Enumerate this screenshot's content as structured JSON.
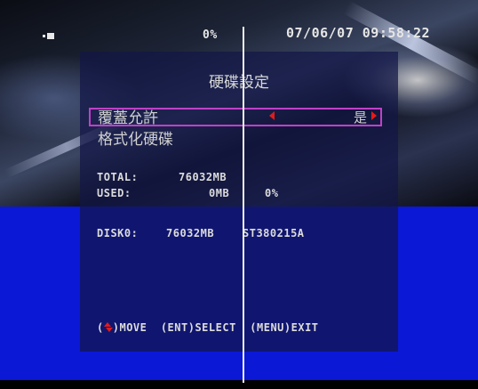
{
  "status_bar": {
    "record_icon": "record-indicator-icon",
    "hdd_percent": "0%",
    "datetime": "07/06/07 09:58:22"
  },
  "panel": {
    "title": "硬碟設定",
    "row_1": {
      "label": "覆蓋允許",
      "value": "是"
    },
    "row_2": {
      "label": "格式化硬碟"
    },
    "total_label": "TOTAL:",
    "total_value": "76032MB",
    "used_label": "USED:",
    "used_value": "0MB",
    "used_percent": "0%",
    "disk_label": "DISK0:",
    "disk_size": "76032MB",
    "disk_model": "ST380215A",
    "footer": {
      "move_icon": "up-down-arrows-icon",
      "move": "MOVE",
      "select": "(ENT)SELECT",
      "exit": "(MENU)EXIT"
    }
  },
  "colors": {
    "highlight_border": "#c040c8",
    "arrow": "#e21b1b",
    "blue_background": "#0b18d6"
  }
}
